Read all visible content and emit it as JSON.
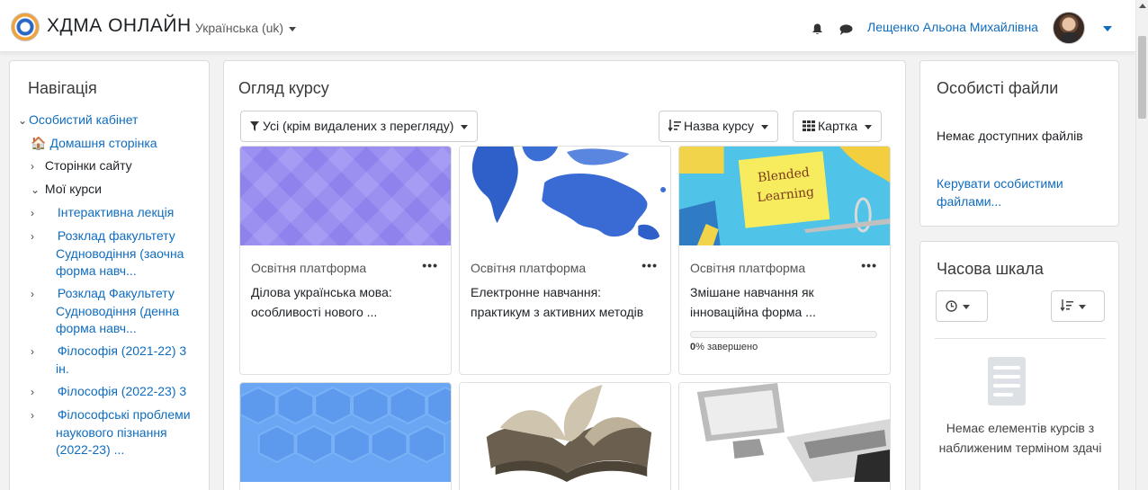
{
  "header": {
    "site_name": "ХДМА ОНЛАЙН",
    "language": "Українська (uk)",
    "user_name": "Лещенко Альона Михайлівна"
  },
  "navigation": {
    "title": "Навігація",
    "items": [
      {
        "label": "Особистий кабінет"
      },
      {
        "label": "Домашня сторінка"
      },
      {
        "label": "Сторінки сайту"
      },
      {
        "label": "Мої курси"
      },
      {
        "label": "Інтерактивна лекція"
      },
      {
        "label": "Розклад факультету Судноводіння (заочна форма навч..."
      },
      {
        "label": "Розклад Факультету Судноводіння (денна форма навч..."
      },
      {
        "label": "Філософія (2021-22) 3 ін."
      },
      {
        "label": "Філософія (2022-23) 3"
      },
      {
        "label": "Філософські проблеми наукового пізнання (2022-23) ..."
      }
    ]
  },
  "course_overview": {
    "title": "Огляд курсу",
    "filter_label": "Усі (крім видалених з перегляду)",
    "sort_label": "Назва курсу",
    "view_label": "Картка",
    "courses": [
      {
        "category": "Освітня платформа",
        "name": "Ділова українська мова: особливості нового ...",
        "progress": null
      },
      {
        "category": "Освітня платформа",
        "name": "Електронне навчання: практикум з активних методів",
        "progress": null
      },
      {
        "category": "Освітня платформа",
        "name": "Змішане навчання як інноваційна форма ...",
        "progress": 0,
        "progress_text": "0",
        "progress_suffix": "% завершено",
        "image_text": "Blended Learning"
      }
    ]
  },
  "private_files": {
    "title": "Особисті файли",
    "empty_text": "Немає доступних файлів",
    "manage_link": "Керувати особистими файлами..."
  },
  "timeline": {
    "title": "Часова шкала",
    "empty_text": "Немає елементів курсів з наближеним терміном здачі"
  },
  "colors": {
    "link": "#0f6cbf",
    "background": "#f2f2f2"
  }
}
